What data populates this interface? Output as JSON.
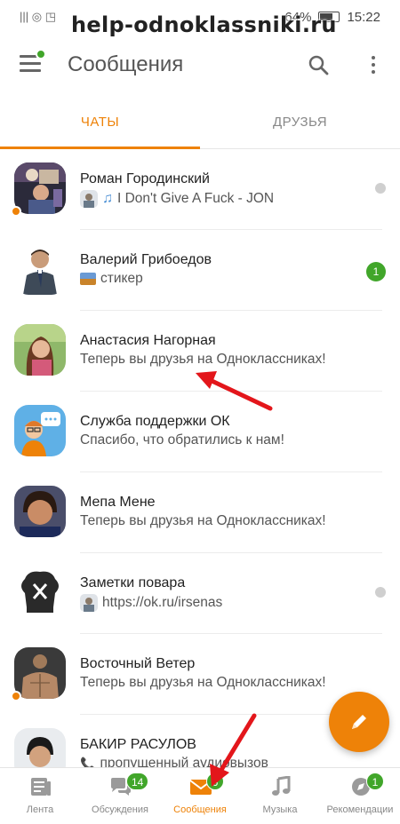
{
  "status_bar": {
    "signal": "||| ◎ ◳",
    "battery_percent": "64%",
    "time": "15:22"
  },
  "watermark": "help-odnoklassniki.ru",
  "header": {
    "title": "Сообщения",
    "menu_has_notification": true
  },
  "tabs": [
    {
      "label": "ЧАТЫ",
      "active": true
    },
    {
      "label": "ДРУЗЬЯ",
      "active": false
    }
  ],
  "chats": [
    {
      "name": "Роман Городинский",
      "message": "I Don't Give A Fuck - JON",
      "prefix_icon": "music-note-icon",
      "has_mini_avatar": true,
      "status": "read",
      "online": true
    },
    {
      "name": "Валерий Грибоедов",
      "message": "стикер",
      "prefix_icon": "sticker-icon",
      "has_mini_avatar": false,
      "status": "unread",
      "unread_count": "1",
      "online": false
    },
    {
      "name": "Анастасия Нагорная",
      "message": "Теперь вы друзья на Одноклассниках!",
      "status": "none",
      "online": false
    },
    {
      "name": "Служба поддержки ОК",
      "message": "Спасибо, что обратились к нам!",
      "status": "none",
      "online": false
    },
    {
      "name": "Мепа Мене",
      "message": "Теперь вы друзья на Одноклассниках!",
      "status": "none",
      "online": false
    },
    {
      "name": "Заметки повара",
      "message": "https://ok.ru/irsenas",
      "has_mini_avatar": true,
      "status": "read",
      "online": false
    },
    {
      "name": "Восточный Ветер",
      "message": "Теперь вы друзья на Одноклассниках!",
      "status": "none",
      "online": true
    },
    {
      "name": "БАКИР РАСУЛОВ",
      "message": "пропущенный аудиовызов",
      "prefix_icon": "phone-icon",
      "status": "none",
      "online": false
    }
  ],
  "fab": {
    "icon": "pencil-icon"
  },
  "bottom_nav": [
    {
      "label": "Лента",
      "icon": "feed-icon",
      "badge": null,
      "active": false
    },
    {
      "label": "Обсуждения",
      "icon": "discussions-icon",
      "badge": "14",
      "active": false
    },
    {
      "label": "Сообщения",
      "icon": "messages-icon",
      "badge": "6",
      "active": true
    },
    {
      "label": "Музыка",
      "icon": "music-icon",
      "badge": null,
      "active": false
    },
    {
      "label": "Рекомендации",
      "icon": "recommendations-icon",
      "badge": "1",
      "active": false
    }
  ],
  "colors": {
    "accent": "#ee8208",
    "green_badge": "#41a62a",
    "annotation_arrow": "#e3161b"
  }
}
